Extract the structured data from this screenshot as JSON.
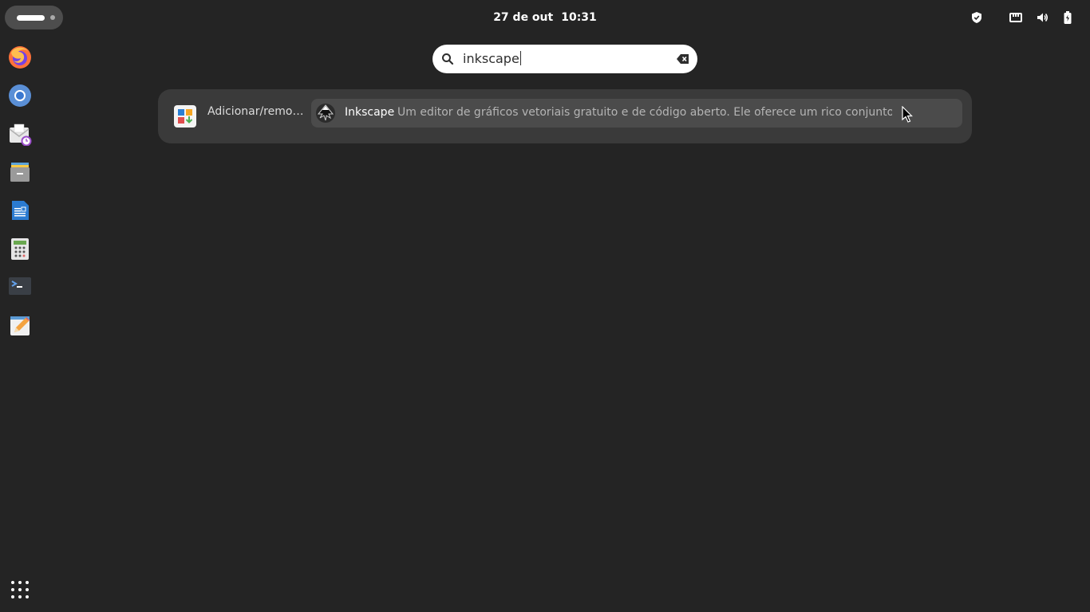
{
  "topbar": {
    "clock_date": "27 de out",
    "clock_time": "10:31",
    "tray_icons": [
      "shield-icon",
      "network-wired-icon",
      "volume-icon",
      "battery-icon"
    ]
  },
  "dock": {
    "items": [
      {
        "name": "firefox",
        "icon": "firefox-icon"
      },
      {
        "name": "chromium",
        "icon": "chromium-icon"
      },
      {
        "name": "mail",
        "icon": "mail-icon"
      },
      {
        "name": "files",
        "icon": "files-icon"
      },
      {
        "name": "writer",
        "icon": "writer-icon"
      },
      {
        "name": "calculator",
        "icon": "calculator-icon"
      },
      {
        "name": "terminal",
        "icon": "terminal-icon"
      },
      {
        "name": "text-editor",
        "icon": "text-editor-icon"
      }
    ],
    "app_grid_icon": "app-grid-icon"
  },
  "search": {
    "value": "inkscape",
    "clear_icon": "clear-icon"
  },
  "results": {
    "provider_label": "Adicionar/remo…",
    "provider_icon": "software-center-icon",
    "items": [
      {
        "title": "Inkscape",
        "description": "Um editor de gráficos vetoriais gratuito e de código aberto. Ele oferece um rico conjunto de",
        "icon": "inkscape-icon"
      }
    ]
  },
  "colors": {
    "background": "#242424",
    "panel": "#3a3a3a",
    "row_highlight": "#4b4b4b"
  }
}
